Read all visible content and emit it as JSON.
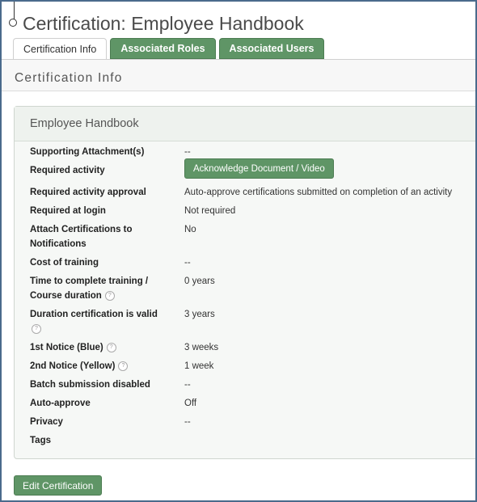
{
  "page": {
    "title": "Certification: Employee Handbook"
  },
  "tabs": [
    {
      "label": "Certification Info",
      "active": true
    },
    {
      "label": "Associated Roles",
      "active": false
    },
    {
      "label": "Associated Users",
      "active": false
    }
  ],
  "section": {
    "title": "Certification Info"
  },
  "panel": {
    "title": "Employee Handbook",
    "rows": {
      "supporting_attachments": {
        "label": "Supporting Attachment(s)",
        "value": "--"
      },
      "required_activity": {
        "label": "Required activity",
        "button": "Acknowledge Document / Video"
      },
      "required_activity_approval": {
        "label": "Required activity approval",
        "value": "Auto-approve certifications submitted on completion of an activity"
      },
      "required_at_login": {
        "label": "Required at login",
        "value": "Not required"
      },
      "attach_certifications": {
        "label_line1": "Attach Certifications to",
        "label_line2": "Notifications",
        "value": "No"
      },
      "cost_of_training": {
        "label": "Cost of training",
        "value": "--"
      },
      "time_to_complete": {
        "label_line1": "Time to complete training /",
        "label_line2": "Course duration",
        "value": "0 years"
      },
      "duration_valid": {
        "label": "Duration certification is valid",
        "value": "3 years"
      },
      "first_notice": {
        "label": "1st Notice (Blue)",
        "value": "3 weeks"
      },
      "second_notice": {
        "label": "2nd Notice (Yellow)",
        "value": "1 week"
      },
      "batch_submission": {
        "label": "Batch submission disabled",
        "value": "--"
      },
      "auto_approve": {
        "label": "Auto-approve",
        "value": "Off"
      },
      "privacy": {
        "label": "Privacy",
        "value": "--"
      },
      "tags": {
        "label": "Tags",
        "value": ""
      }
    }
  },
  "actions": {
    "edit_label": "Edit Certification"
  },
  "icons": {
    "help": "help-circle-icon",
    "help_glyph": "?"
  },
  "colors": {
    "accent": "#5f9566",
    "border": "#4a6a8c"
  }
}
